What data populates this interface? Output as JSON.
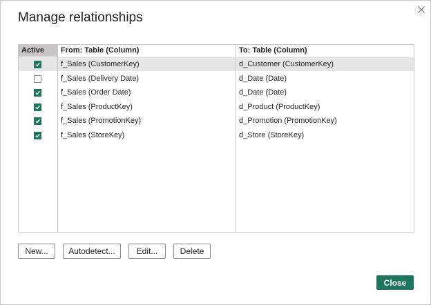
{
  "dialog": {
    "title": "Manage relationships",
    "close_icon": "close-icon"
  },
  "colors": {
    "accent": "#1e7660",
    "selected_row": "#e6e6e6",
    "header_active_bg": "#c8c6c4",
    "border": "#c8c6c4"
  },
  "table": {
    "headers": {
      "active": "Active",
      "from": "From: Table (Column)",
      "to": "To: Table (Column)"
    },
    "rows": [
      {
        "active": true,
        "from": "f_Sales (CustomerKey)",
        "to": "d_Customer (CustomerKey)",
        "selected": true
      },
      {
        "active": false,
        "from": "f_Sales (Delivery Date)",
        "to": "d_Date (Date)",
        "selected": false
      },
      {
        "active": true,
        "from": "f_Sales (Order Date)",
        "to": "d_Date (Date)",
        "selected": false
      },
      {
        "active": true,
        "from": "f_Sales (ProductKey)",
        "to": "d_Product (ProductKey)",
        "selected": false
      },
      {
        "active": true,
        "from": "f_Sales (PromotionKey)",
        "to": "d_Promotion (PromotionKey)",
        "selected": false
      },
      {
        "active": true,
        "from": "f_Sales (StoreKey)",
        "to": "d_Store (StoreKey)",
        "selected": false
      }
    ]
  },
  "buttons": {
    "new": "New...",
    "autodetect": "Autodetect...",
    "edit": "Edit...",
    "delete": "Delete",
    "close": "Close"
  }
}
